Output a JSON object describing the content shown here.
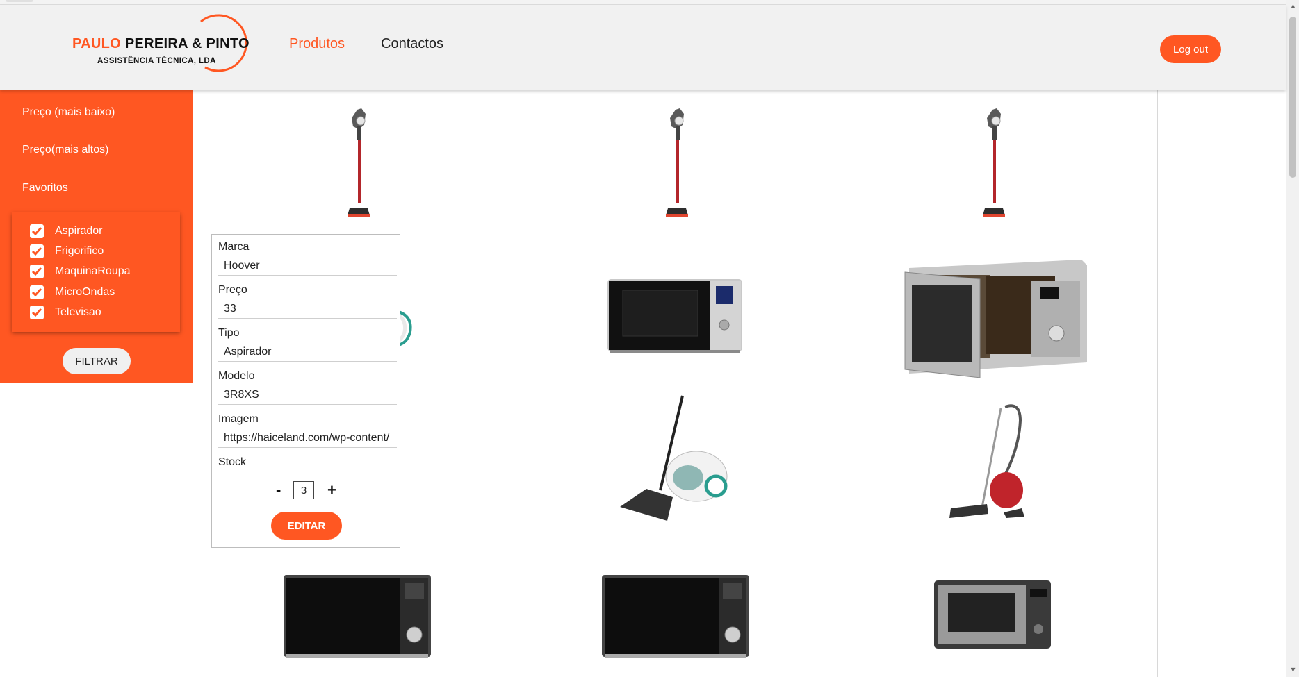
{
  "header": {
    "logo": {
      "name_accent": "PAULO",
      "name_rest": "PEREIRA & PINTO",
      "subtitle": "ASSISTÊNCIA TÉCNICA, LDA"
    },
    "nav": {
      "produtos": "Produtos",
      "contactos": "Contactos"
    },
    "logout_label": "Log out"
  },
  "sidebar": {
    "sort_low": "Preço (mais baixo)",
    "sort_high": "Preço(mais altos)",
    "favorites": "Favoritos",
    "filters": [
      {
        "label": "Aspirador",
        "checked": true
      },
      {
        "label": "Frigorifico",
        "checked": true
      },
      {
        "label": "MaquinaRoupa",
        "checked": true
      },
      {
        "label": "MicroOndas",
        "checked": true
      },
      {
        "label": "Televisao",
        "checked": true
      }
    ],
    "filter_button": "FILTRAR"
  },
  "edit_card": {
    "marca_label": "Marca",
    "marca_value": "Hoover",
    "preco_label": "Preço",
    "preco_value": "33",
    "tipo_label": "Tipo",
    "tipo_value": "Aspirador",
    "modelo_label": "Modelo",
    "modelo_value": "3R8XS",
    "imagem_label": "Imagem",
    "imagem_value": "https://haiceland.com/wp-content/",
    "stock_label": "Stock",
    "stock_minus": "-",
    "stock_value": "3",
    "stock_plus": "+",
    "edit_button": "EDITAR"
  },
  "products": [
    {
      "icon": "stick-vacuum"
    },
    {
      "icon": "stick-vacuum"
    },
    {
      "icon": "stick-vacuum"
    },
    {
      "icon": "canister-vacuum"
    },
    {
      "icon": "microwave-black"
    },
    {
      "icon": "microwave-silver-open"
    },
    {
      "icon": "microwave-black"
    },
    {
      "icon": "canister-vacuum"
    },
    {
      "icon": "canister-vacuum-red"
    },
    {
      "icon": "microwave-black"
    },
    {
      "icon": "microwave-black"
    },
    {
      "icon": "microwave-grey"
    }
  ],
  "colors": {
    "accent": "#ff5722",
    "header_bg": "#f1f1f1"
  }
}
